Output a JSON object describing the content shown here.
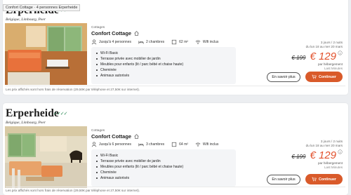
{
  "tooltip": "Confort Cottage · 4 personnes Erperheide",
  "cards": [
    {
      "park_name": "Erperheide",
      "stars": "✓✓✓✓",
      "location": "Belgique, Limbourg, Peer",
      "category": "Cottages",
      "cottage_name": "Confort Cottage",
      "persons": "Jusqu'à 4 personnes",
      "bedrooms": "2 chambres",
      "area": "62 m²",
      "wifi": "Wifi inclus",
      "features": [
        "Wi-Fi Basic",
        "Terrasse privée avec mobilier de jardin",
        "Meubles pour enfants (lit / parc bébé et chaise haute)",
        "Cheminée",
        "Animaux autorisés"
      ],
      "duration": "3 jours / 2 nuits",
      "dates": "du lun 18 au mer 20 mars",
      "old_price": "€ 199",
      "new_price": "€ 129",
      "per_unit": "par hébergement",
      "last_minute": "Last Minutes",
      "more_label": "En savoir plus",
      "continue_label": "Continuer",
      "note": "Les prix affichés sont hors frais de réservation (29,50€ par téléphone et 27,50€ sur internet)."
    },
    {
      "park_name": "Erperheide",
      "stars": "✓✓✓✓",
      "location": "Belgique, Limbourg, Peer",
      "category": "Cottages",
      "cottage_name": "Confort Cottage",
      "persons": "Jusqu'à 6 personnes",
      "bedrooms": "3 chambres",
      "area": "64 m²",
      "wifi": "Wifi inclus",
      "features": [
        "Wi-Fi Basic",
        "Terrasse privée avec mobilier de jardin",
        "Meubles pour enfants (lit / parc bébé et chaise haute)",
        "Cheminée",
        "Animaux autorisés"
      ],
      "duration": "3 jours / 2 nuits",
      "dates": "du lun 18 au mer 20 mars",
      "old_price": "€ 199",
      "new_price": "€ 129",
      "per_unit": "par hébergement",
      "last_minute": "Last Minutes",
      "more_label": "En savoir plus",
      "continue_label": "Continuer",
      "note": "Les prix affichés sont hors frais de réservation (29,50€ par téléphone et 27,50€ sur internet)."
    }
  ],
  "colors": {
    "accent": "#d95a2a",
    "price": "#e2512c",
    "stars": "#2e8b57"
  }
}
